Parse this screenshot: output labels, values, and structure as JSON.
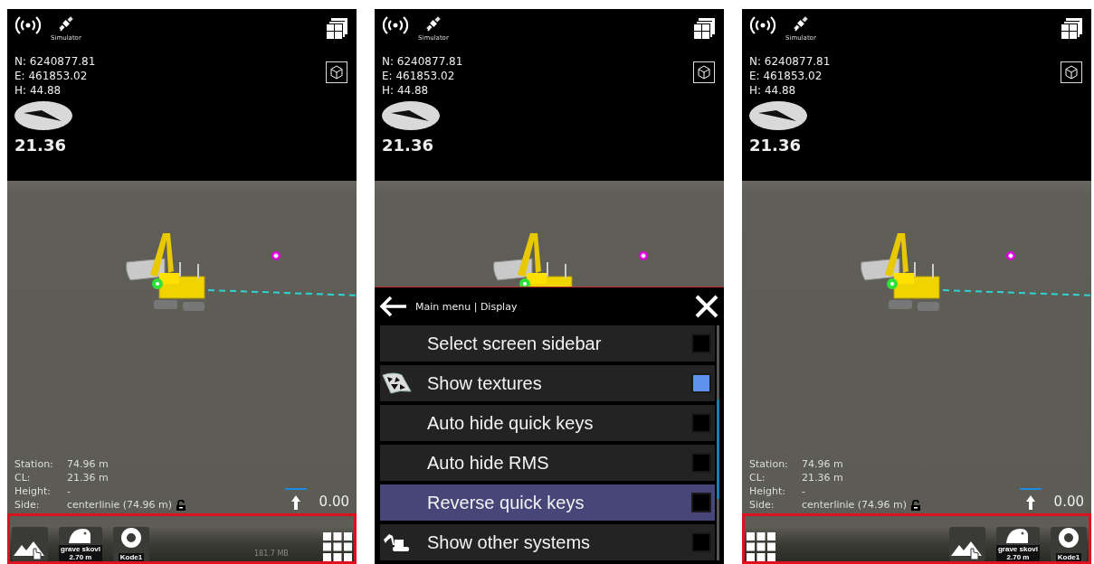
{
  "panels": [
    {
      "top": {
        "gnss_label": "Simulator",
        "coords": [
          "N: 6240877.81",
          "E: 461853.02",
          "H: 44.88"
        ],
        "heading": "21.36"
      },
      "info": [
        {
          "kind": "plain",
          "label": "Station:",
          "value": "74.96 m"
        },
        {
          "kind": "plain",
          "label": "CL:",
          "value": "21.36 m"
        },
        {
          "kind": "plain",
          "label": "Height:",
          "value": "-"
        },
        {
          "kind": "lock",
          "label": "Side:",
          "value": "centerlinie (74.96 m)"
        }
      ],
      "elevation": "0.00",
      "quick_keys_reversed": false,
      "quick_keys": [
        {
          "kind": "terrain"
        },
        {
          "kind": "bucket",
          "label": "grave skovl",
          "value": "2.70 m"
        },
        {
          "kind": "target",
          "label": "Kode1"
        }
      ],
      "memory": "181.7 MB"
    },
    {
      "top": {
        "gnss_label": "Simulator",
        "coords": [
          "N: 6240877.81",
          "E: 461853.02",
          "H: 44.88"
        ],
        "heading": "21.36"
      },
      "menu": {
        "title": "Main menu | Display",
        "items": [
          {
            "label": "Select screen sidebar",
            "kind": "plain",
            "checked": false,
            "selected": false
          },
          {
            "label": "Show textures",
            "kind": "textures",
            "checked": true,
            "selected": false
          },
          {
            "label": "Auto hide quick keys",
            "kind": "plain",
            "checked": false,
            "selected": false
          },
          {
            "label": "Auto hide RMS",
            "kind": "plain",
            "checked": false,
            "selected": false
          },
          {
            "label": "Reverse quick keys",
            "kind": "plain",
            "checked": false,
            "selected": true
          },
          {
            "label": "Show other systems",
            "kind": "machine",
            "checked": false,
            "selected": false
          }
        ]
      }
    },
    {
      "top": {
        "gnss_label": "Simulator",
        "coords": [
          "N: 6240877.81",
          "E: 461853.02",
          "H: 44.88"
        ],
        "heading": "21.36"
      },
      "info": [
        {
          "kind": "plain",
          "label": "Station:",
          "value": "74.96 m"
        },
        {
          "kind": "plain",
          "label": "CL:",
          "value": "21.36 m"
        },
        {
          "kind": "plain",
          "label": "Height:",
          "value": "-"
        },
        {
          "kind": "lock",
          "label": "Side:",
          "value": "centerlinie (74.96 m)"
        }
      ],
      "elevation": "0.00",
      "quick_keys_reversed": true,
      "quick_keys": [
        {
          "kind": "terrain"
        },
        {
          "kind": "bucket",
          "label": "grave skovl",
          "value": "2.70 m"
        },
        {
          "kind": "target",
          "label": "Kode1"
        }
      ]
    }
  ]
}
